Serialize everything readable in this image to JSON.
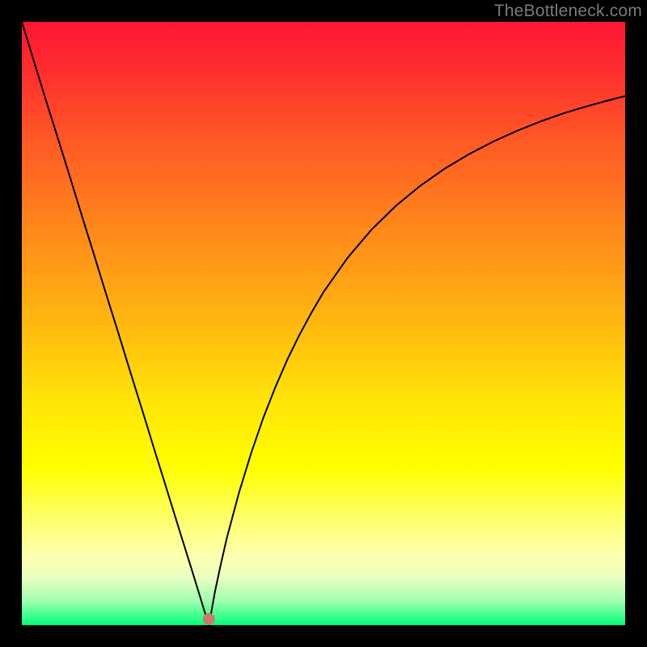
{
  "watermark": "TheBottleneck.com",
  "chart_data": {
    "type": "line",
    "title": "",
    "xlabel": "",
    "ylabel": "",
    "xlim": [
      0,
      100
    ],
    "ylim": [
      0,
      100
    ],
    "grid": false,
    "legend": false,
    "background_gradient": {
      "stops": [
        {
          "offset": 0.0,
          "color": "#ff1533"
        },
        {
          "offset": 0.08,
          "color": "#ff2e2e"
        },
        {
          "offset": 0.2,
          "color": "#ff5a24"
        },
        {
          "offset": 0.35,
          "color": "#ff8a1a"
        },
        {
          "offset": 0.5,
          "color": "#ffb80f"
        },
        {
          "offset": 0.62,
          "color": "#ffe208"
        },
        {
          "offset": 0.74,
          "color": "#ffff00"
        },
        {
          "offset": 0.82,
          "color": "#ffff66"
        },
        {
          "offset": 0.88,
          "color": "#ffffaa"
        },
        {
          "offset": 0.92,
          "color": "#eaffc0"
        },
        {
          "offset": 0.96,
          "color": "#a0ffb0"
        },
        {
          "offset": 1.0,
          "color": "#00ff7a"
        }
      ]
    },
    "marker": {
      "x": 31,
      "y": 1,
      "color": "#c97a6b",
      "radius_pct": 1.0
    },
    "series": [
      {
        "name": "curve",
        "color": "#000000",
        "stroke_width": 2,
        "x": [
          0,
          2,
          4,
          6,
          8,
          10,
          12,
          14,
          16,
          18,
          20,
          22,
          24,
          26,
          28,
          29,
          30,
          30.5,
          31,
          31.5,
          32,
          33,
          34,
          36,
          38,
          40,
          42,
          44,
          46,
          48,
          50,
          54,
          58,
          62,
          66,
          70,
          74,
          78,
          82,
          86,
          90,
          94,
          98,
          100
        ],
        "y": [
          100,
          93.5,
          87.0,
          80.6,
          74.2,
          67.7,
          61.3,
          54.8,
          48.4,
          41.9,
          35.5,
          29.0,
          22.6,
          16.1,
          9.7,
          6.5,
          3.2,
          1.6,
          0.0,
          2.7,
          5.5,
          10.2,
          14.5,
          22.0,
          28.5,
          34.3,
          39.4,
          44.0,
          48.1,
          51.8,
          55.2,
          60.9,
          65.6,
          69.5,
          72.8,
          75.6,
          78.0,
          80.1,
          81.9,
          83.5,
          84.9,
          86.1,
          87.2,
          87.7
        ]
      }
    ]
  }
}
